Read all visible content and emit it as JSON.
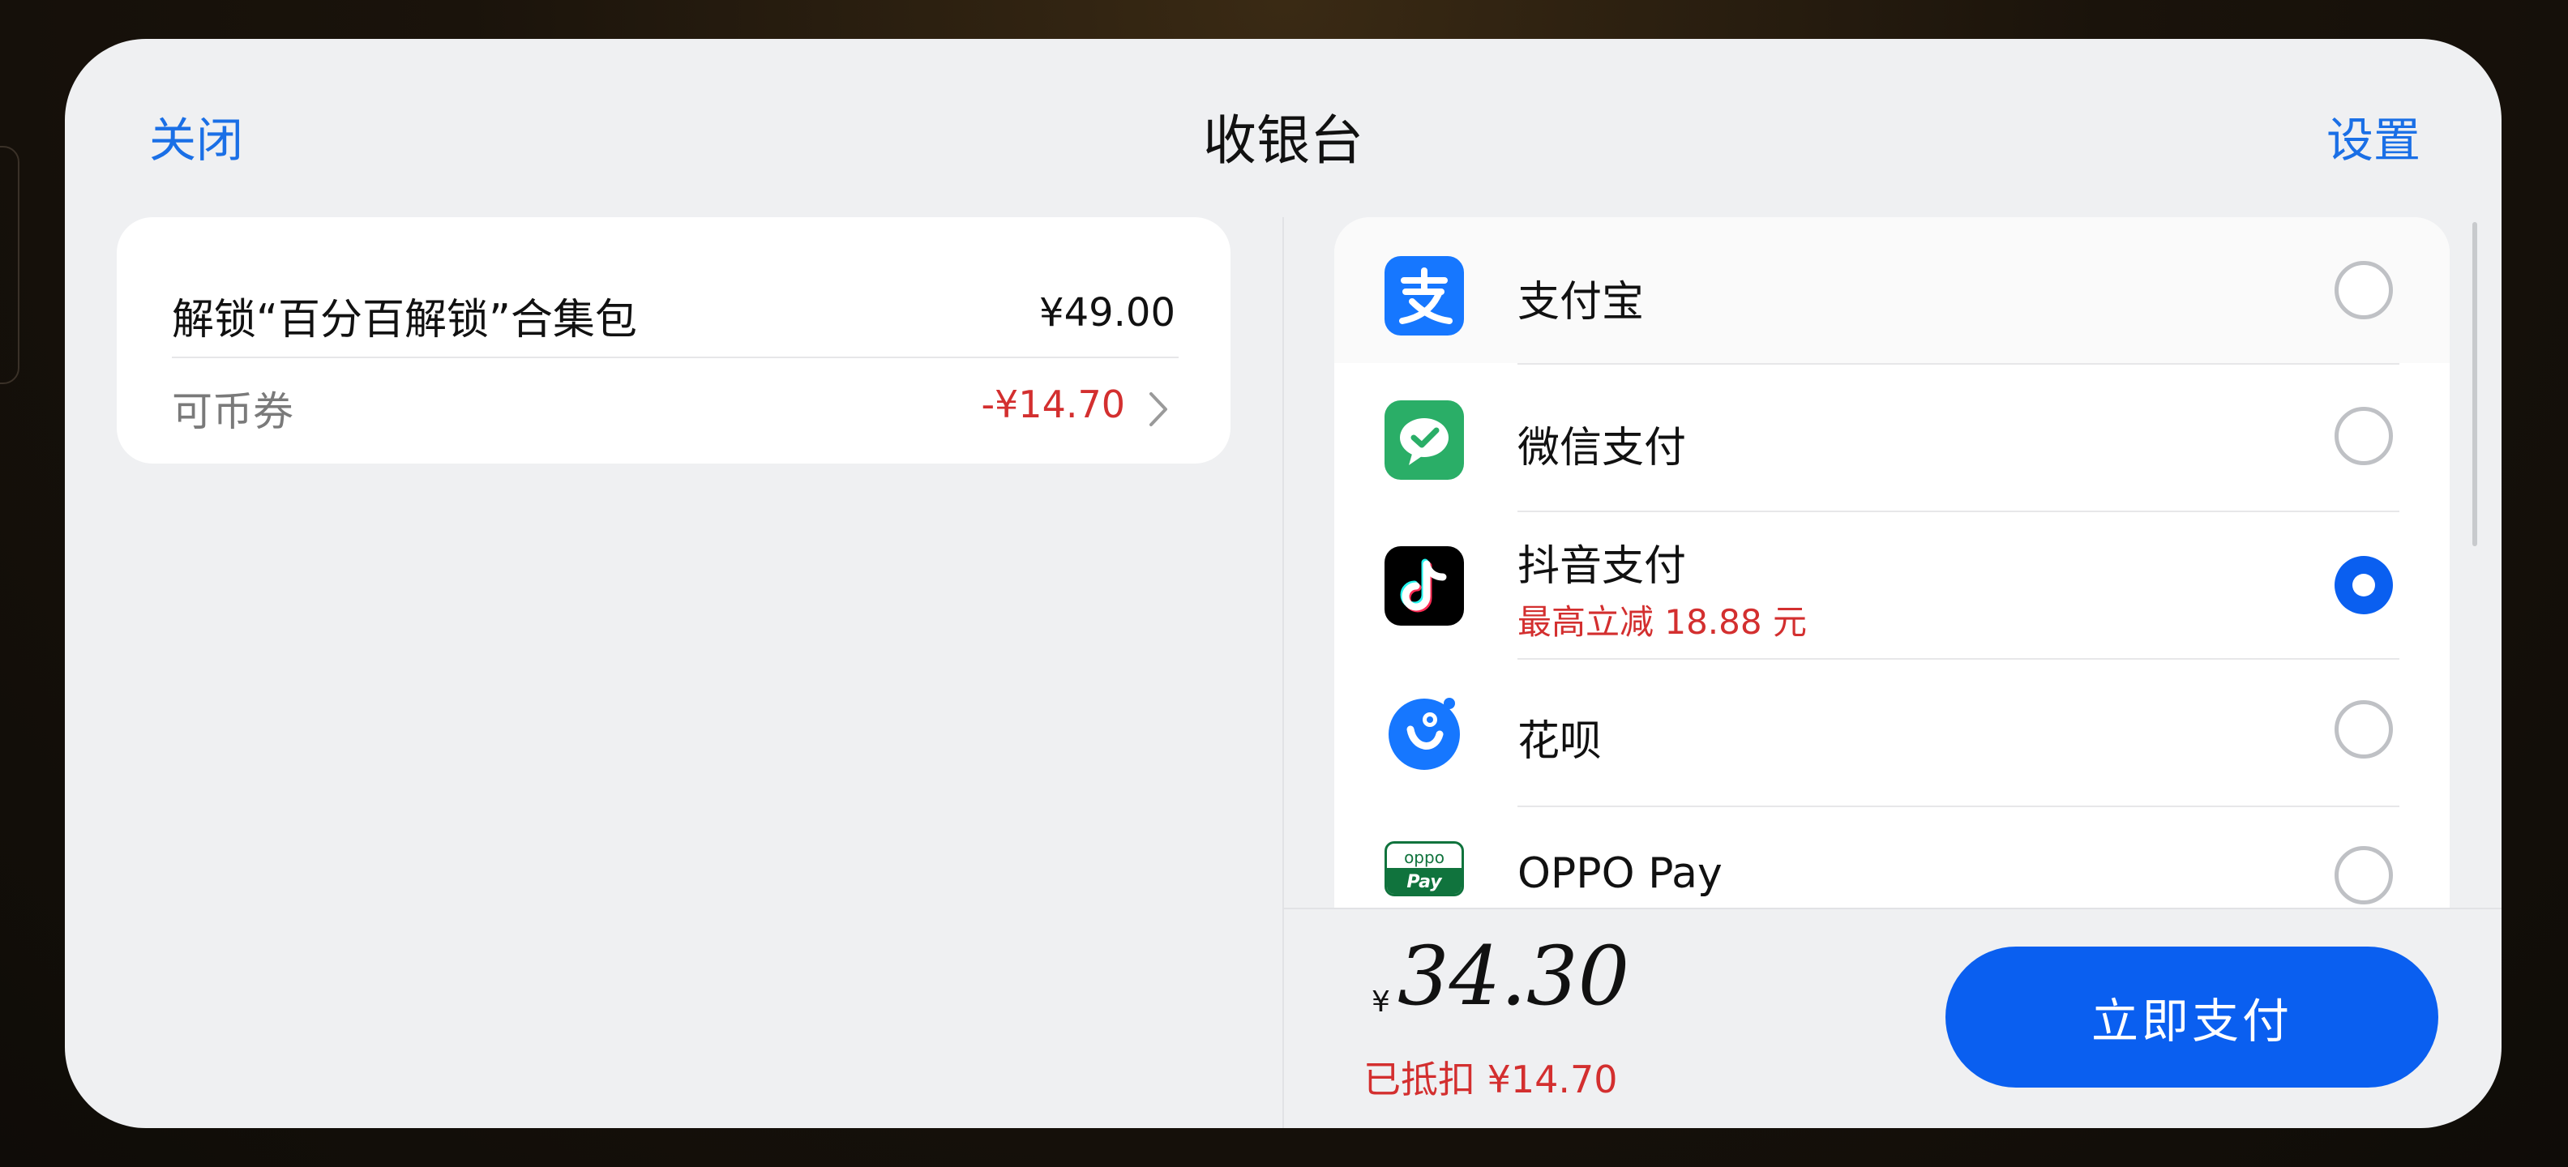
{
  "header": {
    "close_label": "关闭",
    "title": "收银台",
    "settings_label": "设置"
  },
  "order": {
    "item_name": "解锁“百分百解锁”合集包",
    "item_price": "¥49.00",
    "coupon_label": "可币券",
    "coupon_value": "-¥14.70"
  },
  "payment_methods": [
    {
      "label": "支付宝",
      "icon": "alipay-icon",
      "selected": false,
      "promo": ""
    },
    {
      "label": "微信支付",
      "icon": "wechat-pay-icon",
      "selected": false,
      "promo": ""
    },
    {
      "label": "抖音支付",
      "icon": "douyin-pay-icon",
      "selected": true,
      "promo": "最高立减 18.88 元"
    },
    {
      "label": "花呗",
      "icon": "huabei-icon",
      "selected": false,
      "promo": ""
    },
    {
      "label": "OPPO Pay",
      "icon": "oppo-pay-icon",
      "selected": false,
      "promo": ""
    }
  ],
  "icon_text": {
    "oppo_top": "oppo",
    "oppo_bottom": "Pay"
  },
  "footer": {
    "currency_symbol": "¥",
    "total_amount": "34.30",
    "deduction_text": "已抵扣 ¥14.70",
    "pay_button_label": "立即支付"
  },
  "colors": {
    "accent": "#0a5ff0",
    "link": "#1a6fe6",
    "discount_red": "#d32f2f",
    "alipay": "#1677ff",
    "wechat": "#2aae67",
    "douyin": "#000000",
    "oppo": "#10733d"
  }
}
